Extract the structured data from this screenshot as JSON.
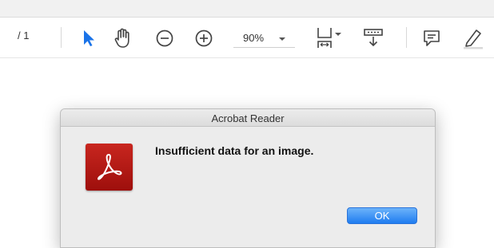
{
  "toolbar": {
    "page_count": "/ 1",
    "zoom_value": "90%",
    "icons": [
      "select-arrow-icon",
      "hand-tool-icon",
      "zoom-out-icon",
      "zoom-in-icon",
      "fit-page-icon",
      "scroll-mode-icon",
      "comment-icon",
      "highlight-pen-icon"
    ],
    "accent_color": "#1a73e8"
  },
  "dialog": {
    "title": "Acrobat Reader",
    "message": "Insufficient data for an image.",
    "ok_label": "OK",
    "icon": "acrobat-reader-icon",
    "icon_color": "#b81a16",
    "button_color": "#2f86f5"
  }
}
